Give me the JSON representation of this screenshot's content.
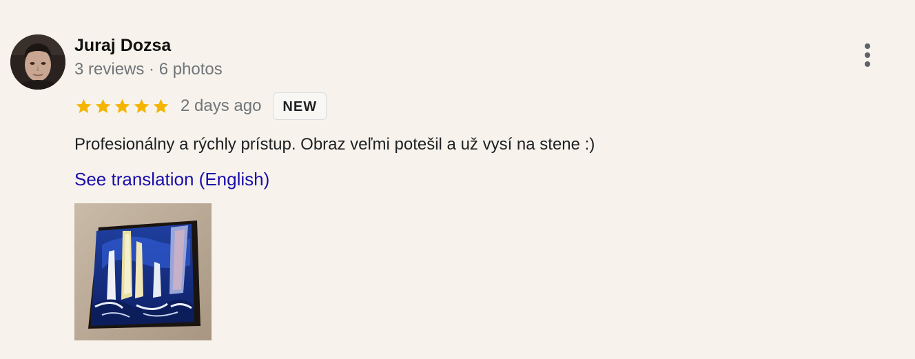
{
  "reviewer": {
    "name": "Juraj Dozsa",
    "meta": "3 reviews · 6 photos",
    "avatar_icon": "person-avatar"
  },
  "review": {
    "rating": 5,
    "rating_max": 5,
    "star_color": "#f4b400",
    "date": "2 days ago",
    "badge": "NEW",
    "text": "Profesionálny a rýchly prístup. Obraz veľmi potešil a už vysí na stene :)",
    "translate_link": "See translation (English)"
  },
  "menu_icon": "more-vert-icon",
  "colors": {
    "background": "#f7f3ec",
    "link": "#1a0dab",
    "secondary_text": "#70757a"
  }
}
